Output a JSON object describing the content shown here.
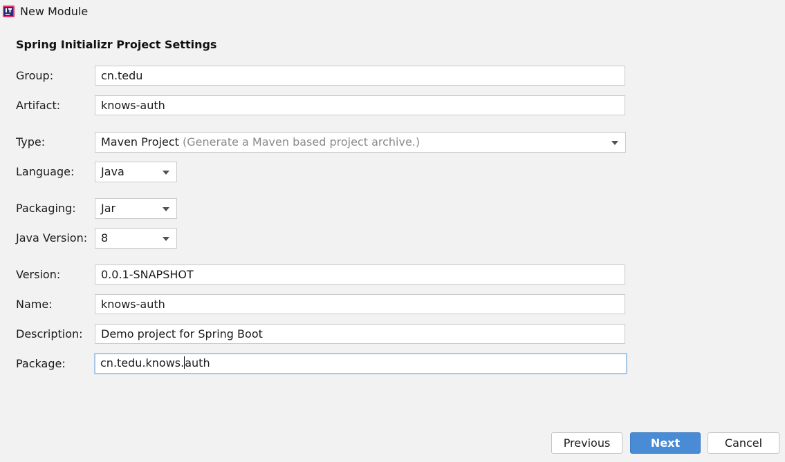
{
  "window": {
    "title": "New Module",
    "icon": "intellij-app-icon"
  },
  "form": {
    "heading": "Spring Initializr Project Settings",
    "group": {
      "label": "Group:",
      "value": "cn.tedu"
    },
    "artifact": {
      "label": "Artifact:",
      "value": "knows-auth"
    },
    "type": {
      "label": "Type:",
      "value": "Maven Project",
      "hint": "(Generate a Maven based project archive.)"
    },
    "language": {
      "label": "Language:",
      "value": "Java"
    },
    "packaging": {
      "label": "Packaging:",
      "value": "Jar"
    },
    "java_version": {
      "label": "Java Version:",
      "value": "8"
    },
    "version": {
      "label": "Version:",
      "value": "0.0.1-SNAPSHOT"
    },
    "name": {
      "label": "Name:",
      "value": "knows-auth"
    },
    "description": {
      "label": "Description:",
      "value": "Demo project for Spring Boot"
    },
    "package": {
      "label": "Package:",
      "value_before_caret": "cn.tedu.knows.",
      "value_after_caret": "auth"
    }
  },
  "buttons": {
    "previous": "Previous",
    "next": "Next",
    "cancel": "Cancel"
  },
  "colors": {
    "background": "#f2f2f2",
    "primary_button": "#4a8bd6",
    "focus_border": "#a8c8e8"
  }
}
